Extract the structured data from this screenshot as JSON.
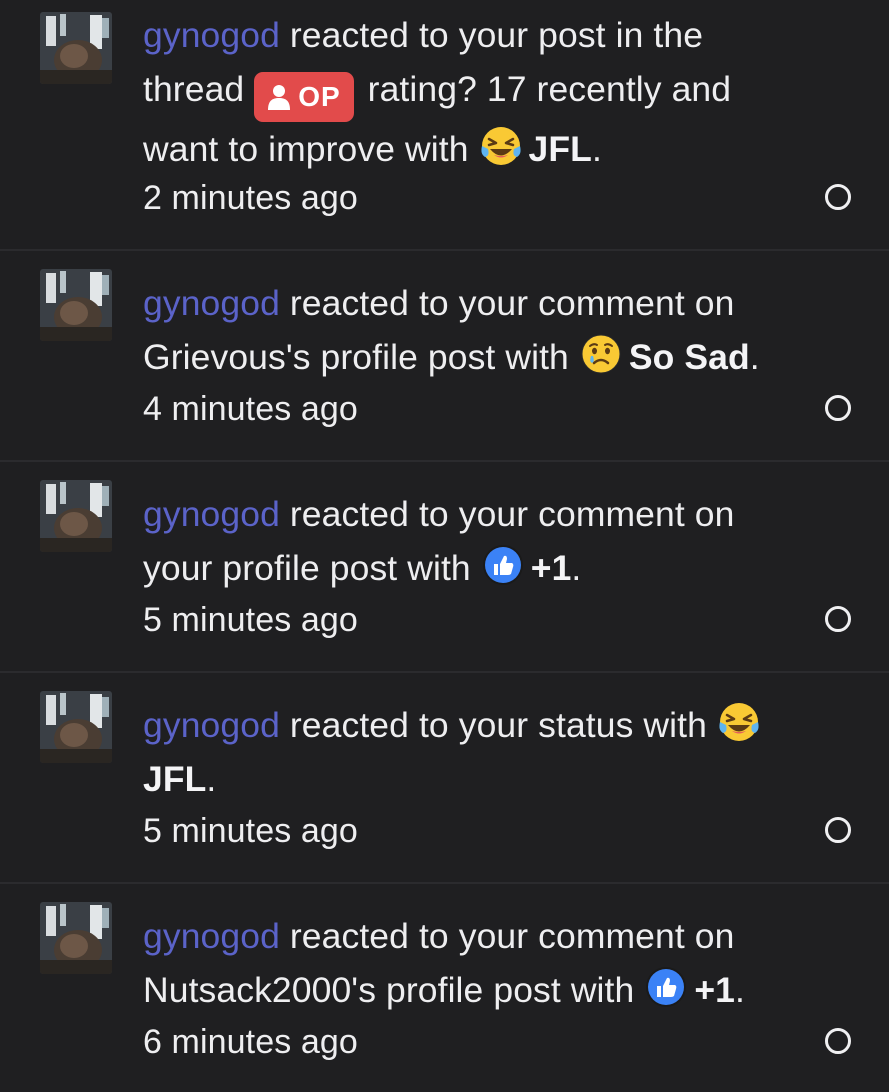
{
  "alerts": [
    {
      "username": "gynogod",
      "text_before": " reacted to your post in the thread ",
      "badge": "OP",
      "text_after": " rating? 17 recently and want to improve with ",
      "reaction_icon": "laughing-crying-icon",
      "reaction": "JFL",
      "period": ".",
      "time": "2 minutes ago"
    },
    {
      "username": "gynogod",
      "text_before": " reacted to your comment on Grievous's profile post with ",
      "reaction_icon": "sad-face-icon",
      "reaction": "So Sad",
      "period": ".",
      "time": "4 minutes ago"
    },
    {
      "username": "gynogod",
      "text_before": " reacted to your comment on your profile post with ",
      "reaction_icon": "thumbs-up-icon",
      "reaction": "+1",
      "period": ".",
      "time": "5 minutes ago"
    },
    {
      "username": "gynogod",
      "text_before": " reacted to your status with ",
      "reaction_icon": "laughing-crying-icon",
      "reaction": "JFL",
      "period": ".",
      "time": "5 minutes ago"
    },
    {
      "username": "gynogod",
      "text_before": " reacted to your comment on Nutsack2000's profile post with ",
      "reaction_icon": "thumbs-up-icon",
      "reaction": "+1",
      "period": ".",
      "time": "6 minutes ago"
    }
  ],
  "colors": {
    "background": "#1f1f21",
    "username": "#5b63c9",
    "op_badge": "#e24b4b",
    "text": "#eeeef0"
  }
}
